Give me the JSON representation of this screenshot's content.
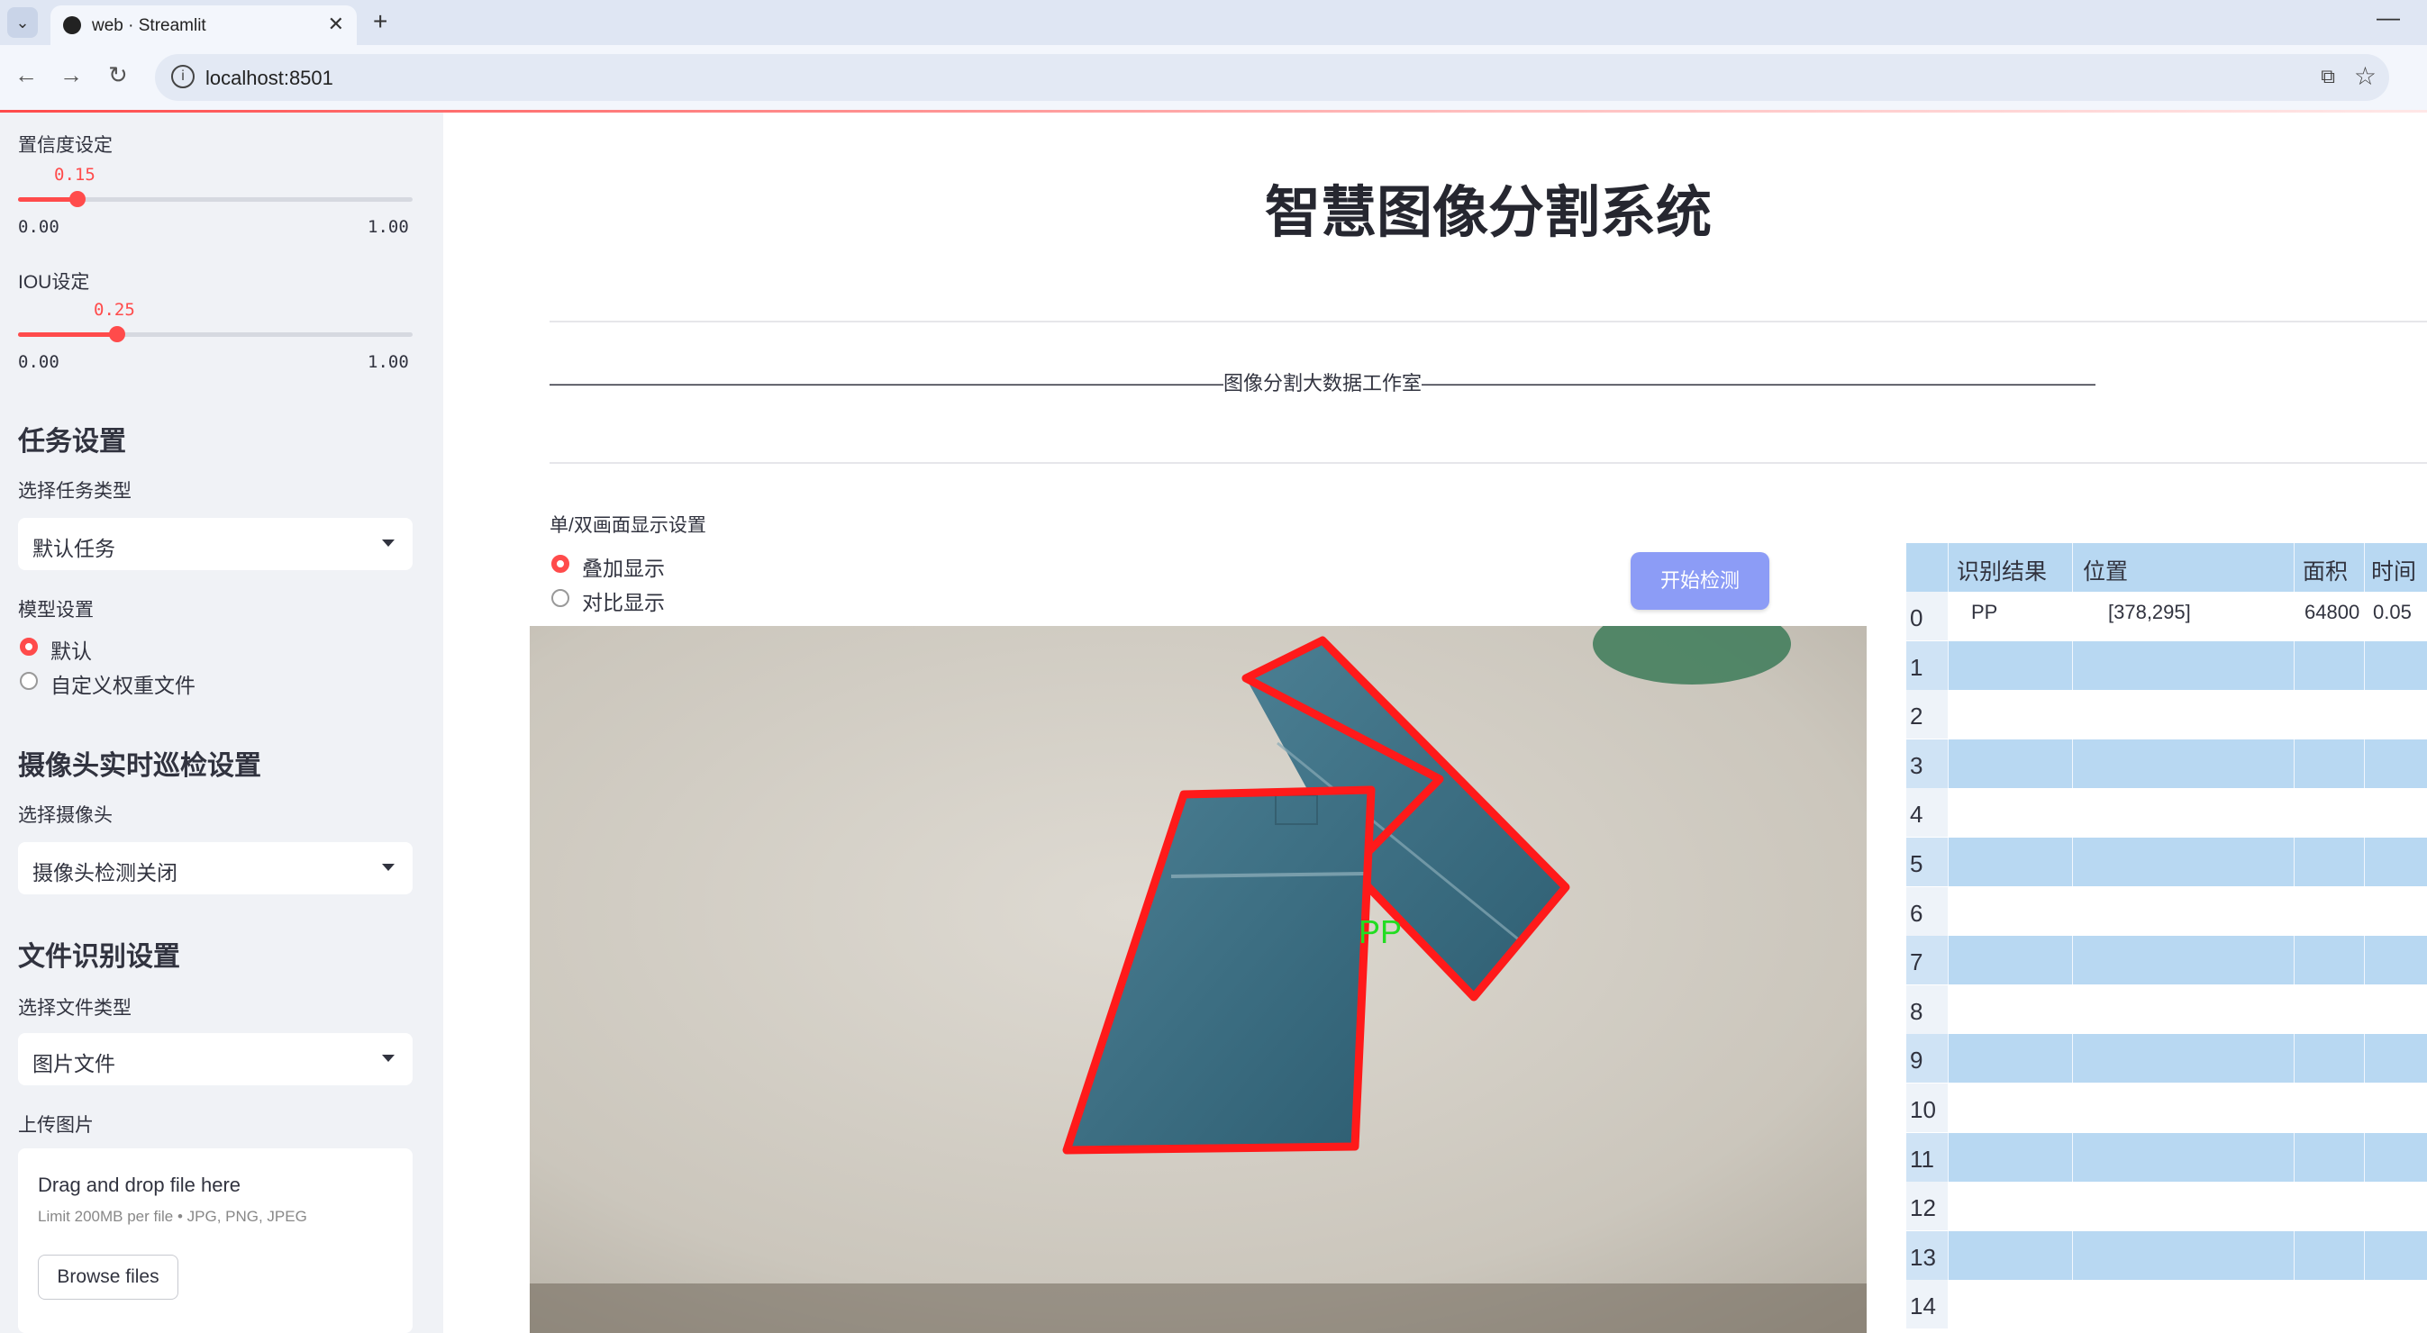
{
  "browser": {
    "tab_title": "web · Streamlit",
    "url": "localhost:8501"
  },
  "sidebar": {
    "confidence": {
      "label": "置信度设定",
      "value": "0.15",
      "min": "0.00",
      "max": "1.00",
      "fraction": 0.15
    },
    "iou": {
      "label": "IOU设定",
      "value": "0.25",
      "min": "0.00",
      "max": "1.00",
      "fraction": 0.25
    },
    "task_section": "任务设置",
    "task_type_label": "选择任务类型",
    "task_type_value": "默认任务",
    "model_label": "模型设置",
    "model_options": [
      "默认",
      "自定义权重文件"
    ],
    "model_selected": 0,
    "camera_section": "摄像头实时巡检设置",
    "camera_label": "选择摄像头",
    "camera_value": "摄像头检测关闭",
    "file_section": "文件识别设置",
    "file_type_label": "选择文件类型",
    "file_type_value": "图片文件",
    "upload_label": "上传图片",
    "upload_title": "Drag and drop file here",
    "upload_sub": "Limit 200MB per file • JPG, PNG, JPEG",
    "upload_button": "Browse files"
  },
  "main": {
    "title": "智慧图像分割系统",
    "studio_line": "——————————————————————————————————图像分割大数据工作室——————————————————————————————————",
    "display_label": "单/双画面显示设置",
    "display_options": [
      "叠加显示",
      "对比显示"
    ],
    "display_selected": 0,
    "start_button": "开始检测",
    "detection_label": "PP"
  },
  "table": {
    "headers": [
      "识别结果",
      "位置",
      "面积",
      "时间"
    ],
    "rows": [
      {
        "index": "0",
        "result": "PP",
        "position": "[378,295]",
        "area": "64800",
        "time": "0.05"
      },
      {
        "index": "1"
      },
      {
        "index": "2"
      },
      {
        "index": "3"
      },
      {
        "index": "4"
      },
      {
        "index": "5"
      },
      {
        "index": "6"
      },
      {
        "index": "7"
      },
      {
        "index": "8"
      },
      {
        "index": "9"
      },
      {
        "index": "10"
      },
      {
        "index": "11"
      },
      {
        "index": "12"
      },
      {
        "index": "13"
      },
      {
        "index": "14"
      }
    ]
  },
  "colors": {
    "accent": "#ff4b4b",
    "button": "#8c9cf6",
    "table_stripe": "#b8d8f2",
    "sidebar_bg": "#f0f2f6",
    "mask_outline": "#ff1a1a",
    "label_green": "#22dd22"
  }
}
